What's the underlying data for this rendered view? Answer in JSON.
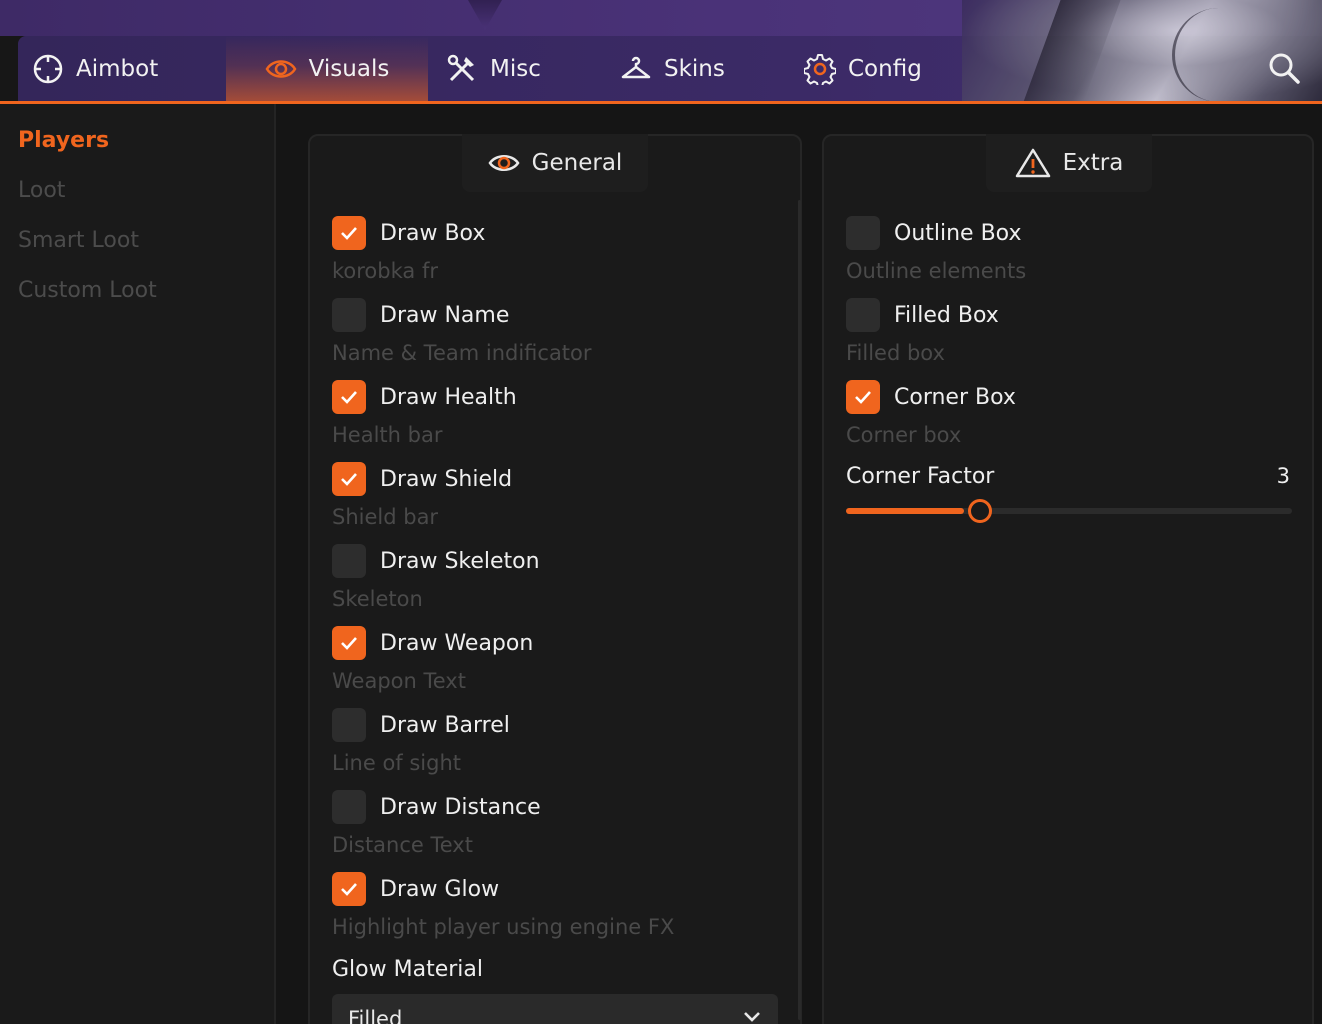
{
  "colors": {
    "accent": "#f0651e",
    "purple": "#3b2a66"
  },
  "tabs": [
    {
      "label": "Aimbot",
      "icon": "crosshair-icon"
    },
    {
      "label": "Visuals",
      "icon": "eye-icon"
    },
    {
      "label": "Misc",
      "icon": "tools-icon"
    },
    {
      "label": "Skins",
      "icon": "hanger-icon"
    },
    {
      "label": "Config",
      "icon": "gear-icon"
    }
  ],
  "active_tab": "Visuals",
  "sidebar": {
    "items": [
      {
        "label": "Players",
        "active": true
      },
      {
        "label": "Loot",
        "active": false
      },
      {
        "label": "Smart Loot",
        "active": false
      },
      {
        "label": "Custom Loot",
        "active": false
      }
    ]
  },
  "general": {
    "title": "General",
    "options": [
      {
        "label": "Draw Box",
        "desc": "korobka fr",
        "checked": true
      },
      {
        "label": "Draw Name",
        "desc": "Name & Team indificator",
        "checked": false
      },
      {
        "label": "Draw Health",
        "desc": "Health bar",
        "checked": true
      },
      {
        "label": "Draw Shield",
        "desc": "Shield bar",
        "checked": true
      },
      {
        "label": "Draw Skeleton",
        "desc": "Skeleton",
        "checked": false
      },
      {
        "label": "Draw Weapon",
        "desc": "Weapon Text",
        "checked": true
      },
      {
        "label": "Draw Barrel",
        "desc": "Line of sight",
        "checked": false
      },
      {
        "label": "Draw Distance",
        "desc": "Distance Text",
        "checked": false
      },
      {
        "label": "Draw Glow",
        "desc": "Highlight player using engine FX",
        "checked": true
      }
    ],
    "glow_material": {
      "label": "Glow Material",
      "value": "Filled"
    }
  },
  "extra": {
    "title": "Extra",
    "options": [
      {
        "label": "Outline Box",
        "desc": "Outline elements",
        "checked": false
      },
      {
        "label": "Filled Box",
        "desc": "Filled box",
        "checked": false
      },
      {
        "label": "Corner Box",
        "desc": "Corner box",
        "checked": true
      }
    ],
    "corner_factor": {
      "label": "Corner Factor",
      "value": "3",
      "fraction": 0.3
    }
  }
}
